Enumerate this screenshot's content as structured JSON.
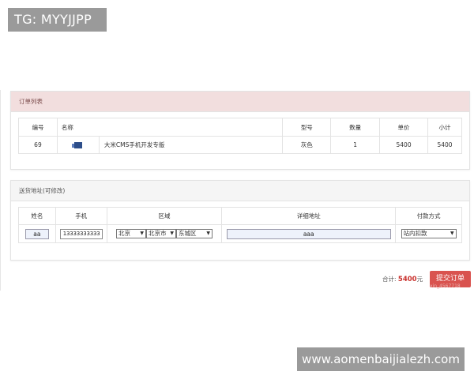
{
  "watermarks": {
    "top": "TG: MYYJJPP",
    "bottom": "www.aomenbaijialezh.com"
  },
  "orders": {
    "title": "订单列表",
    "headers": [
      "编号",
      "名称",
      "型号",
      "数量",
      "单价",
      "小计"
    ],
    "rows": [
      {
        "id": "69",
        "name": "大米CMS手机开发专版",
        "model": "灰色",
        "qty": "1",
        "price": "5400",
        "subtotal": "5400"
      }
    ]
  },
  "address": {
    "title": "送货地址(可修改)",
    "headers": [
      "姓名",
      "手机",
      "区域",
      "详细地址",
      "付款方式"
    ],
    "name_value": "aa",
    "phone_value": "13333333333",
    "province": "北京",
    "city": "北京市",
    "district": "东城区",
    "detail_value": "aaa",
    "payment": "站内扣款"
  },
  "summary": {
    "total_label": "合计:",
    "total_amount": "5400",
    "currency": "元",
    "submit_label": "提交订单",
    "faint_text": "xin_4567718"
  },
  "colors": {
    "orders_header_bg": "#f2dede",
    "submit_bg": "#d9534f",
    "total_color": "#c9302c",
    "thumb": "#2d4e8a"
  }
}
